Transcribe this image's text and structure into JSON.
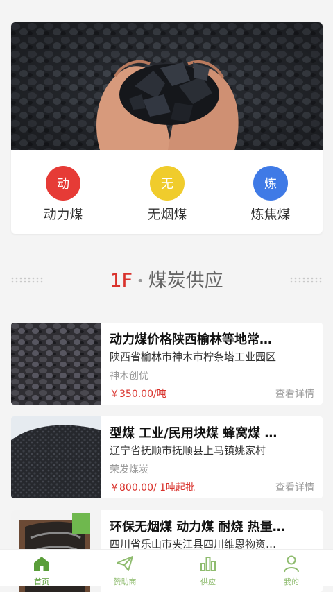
{
  "categories": [
    {
      "icon_char": "动",
      "label": "动力煤",
      "color": "#e63b36"
    },
    {
      "icon_char": "无",
      "label": "无烟煤",
      "color": "#f0cc2c"
    },
    {
      "icon_char": "炼",
      "label": "炼焦煤",
      "color": "#3f7ae6"
    }
  ],
  "floor": {
    "number": "1F",
    "separator": "•",
    "title": "煤炭供应"
  },
  "products": [
    {
      "title": "动力煤价格陕西榆林等地常…",
      "address": "陕西省榆林市神木市柠条塔工业园区",
      "company": "神木创优",
      "price": "￥350.00/吨",
      "detail": "查看详情"
    },
    {
      "title": "型煤 工业/民用块煤 蜂窝煤 …",
      "address": "辽宁省抚顺市抚顺县上马镇姚家村",
      "company": "荣发煤炭",
      "price": "￥800.00/ 1吨起批",
      "detail": "查看详情"
    },
    {
      "title": "环保无烟煤 动力煤 耐烧 热量…",
      "address": "四川省乐山市夹江县四川维恩物资…",
      "company": "",
      "price": "",
      "detail": ""
    }
  ],
  "tabs": [
    {
      "label": "首页",
      "icon": "home-icon",
      "active": true
    },
    {
      "label": "赞助商",
      "icon": "paper-plane-icon",
      "active": false
    },
    {
      "label": "供应",
      "icon": "bar-chart-icon",
      "active": false
    },
    {
      "label": "我的",
      "icon": "user-icon",
      "active": false
    }
  ],
  "colors": {
    "accent": "#5a9e3a",
    "inactive_tab": "#8fbc6f",
    "price": "#d9322c"
  }
}
